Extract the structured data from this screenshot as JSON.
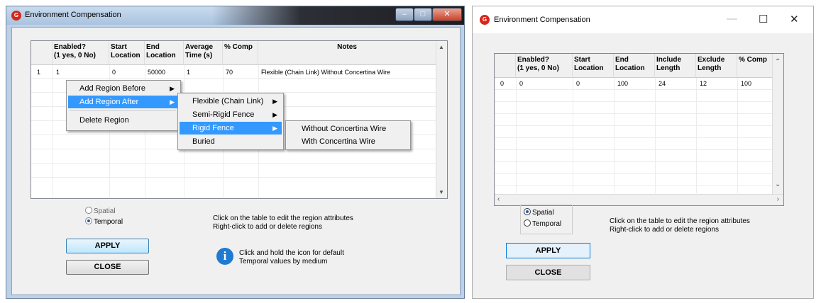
{
  "left_window": {
    "title": "Environment Compensation",
    "table": {
      "headers": [
        "Enabled?\n(1 yes, 0 No)",
        "Start\nLocation",
        "End\nLocation",
        "Average\nTime (s)",
        "% Comp",
        "Notes"
      ],
      "rows": [
        [
          "1",
          "1",
          "0",
          "50000",
          "1",
          "70",
          "Flexible (Chain Link) Without Concertina Wire"
        ]
      ]
    },
    "context_menu": {
      "items": [
        "Add Region Before",
        "Add Region After",
        "Delete Region"
      ],
      "submenu": [
        "Flexible (Chain Link)",
        "Semi-Rigid Fence",
        "Rigid Fence",
        "Buried"
      ],
      "subsubmenu": [
        "Without Concertina Wire",
        "With Concertina Wire"
      ]
    },
    "radios": [
      {
        "label": "Spatial",
        "selected": false
      },
      {
        "label": "Temporal",
        "selected": true
      }
    ],
    "hint_line1": "Click on the table to edit the region attributes",
    "hint_line2": "Right-click to add or delete regions",
    "info_line1": "Click and hold the icon for default",
    "info_line2": "Temporal values by medium",
    "apply_label": "APPLY",
    "close_label": "CLOSE",
    "window_controls": {
      "minimize": "–",
      "maximize": "□",
      "close": "✕"
    }
  },
  "right_window": {
    "title": "Environment Compensation",
    "window_controls": {
      "minimize": "—",
      "maximize": "☐",
      "close": "✕"
    },
    "table": {
      "headers": [
        "Enabled?\n(1 yes, 0 No)",
        "Start\nLocation",
        "End\nLocation",
        "Include\nLength",
        "Exclude\nLength",
        "% Comp"
      ],
      "rows": [
        [
          "0",
          "0",
          "0",
          "100",
          "24",
          "12",
          "100"
        ]
      ]
    },
    "radios": [
      {
        "label": "Spatial",
        "selected": true
      },
      {
        "label": "Temporal",
        "selected": false
      }
    ],
    "hint_line1": "Click on the table to edit the region attributes",
    "hint_line2": "Right-click to add or delete regions",
    "apply_label": "APPLY",
    "close_label": "CLOSE"
  },
  "icons": {
    "app": "app-logo-icon",
    "info": "info-icon",
    "scroll_up": "chevron-up-icon",
    "scroll_down": "chevron-down-icon",
    "scroll_left": "chevron-left-icon",
    "scroll_right": "chevron-right-icon",
    "submenu": "triangle-right-icon"
  },
  "colors": {
    "menu_highlight": "#3399ff",
    "default_button_border": "#0078d7",
    "app_icon": "#d5261b",
    "info_icon": "#1f7ad0"
  }
}
